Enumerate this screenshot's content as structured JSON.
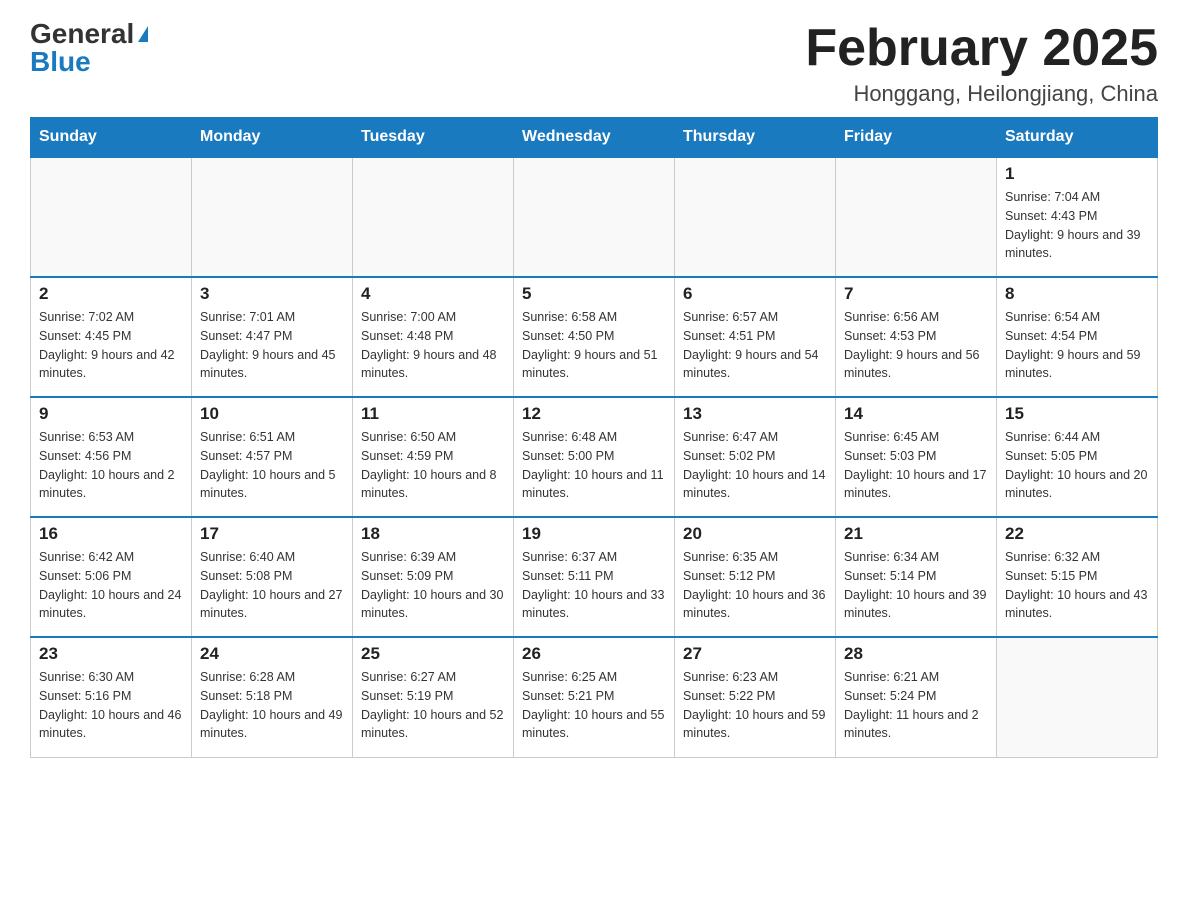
{
  "header": {
    "logo_general": "General",
    "logo_blue": "Blue",
    "month_title": "February 2025",
    "location": "Honggang, Heilongjiang, China"
  },
  "days_of_week": [
    "Sunday",
    "Monday",
    "Tuesday",
    "Wednesday",
    "Thursday",
    "Friday",
    "Saturday"
  ],
  "weeks": [
    [
      {
        "day": "",
        "info": ""
      },
      {
        "day": "",
        "info": ""
      },
      {
        "day": "",
        "info": ""
      },
      {
        "day": "",
        "info": ""
      },
      {
        "day": "",
        "info": ""
      },
      {
        "day": "",
        "info": ""
      },
      {
        "day": "1",
        "info": "Sunrise: 7:04 AM\nSunset: 4:43 PM\nDaylight: 9 hours and 39 minutes."
      }
    ],
    [
      {
        "day": "2",
        "info": "Sunrise: 7:02 AM\nSunset: 4:45 PM\nDaylight: 9 hours and 42 minutes."
      },
      {
        "day": "3",
        "info": "Sunrise: 7:01 AM\nSunset: 4:47 PM\nDaylight: 9 hours and 45 minutes."
      },
      {
        "day": "4",
        "info": "Sunrise: 7:00 AM\nSunset: 4:48 PM\nDaylight: 9 hours and 48 minutes."
      },
      {
        "day": "5",
        "info": "Sunrise: 6:58 AM\nSunset: 4:50 PM\nDaylight: 9 hours and 51 minutes."
      },
      {
        "day": "6",
        "info": "Sunrise: 6:57 AM\nSunset: 4:51 PM\nDaylight: 9 hours and 54 minutes."
      },
      {
        "day": "7",
        "info": "Sunrise: 6:56 AM\nSunset: 4:53 PM\nDaylight: 9 hours and 56 minutes."
      },
      {
        "day": "8",
        "info": "Sunrise: 6:54 AM\nSunset: 4:54 PM\nDaylight: 9 hours and 59 minutes."
      }
    ],
    [
      {
        "day": "9",
        "info": "Sunrise: 6:53 AM\nSunset: 4:56 PM\nDaylight: 10 hours and 2 minutes."
      },
      {
        "day": "10",
        "info": "Sunrise: 6:51 AM\nSunset: 4:57 PM\nDaylight: 10 hours and 5 minutes."
      },
      {
        "day": "11",
        "info": "Sunrise: 6:50 AM\nSunset: 4:59 PM\nDaylight: 10 hours and 8 minutes."
      },
      {
        "day": "12",
        "info": "Sunrise: 6:48 AM\nSunset: 5:00 PM\nDaylight: 10 hours and 11 minutes."
      },
      {
        "day": "13",
        "info": "Sunrise: 6:47 AM\nSunset: 5:02 PM\nDaylight: 10 hours and 14 minutes."
      },
      {
        "day": "14",
        "info": "Sunrise: 6:45 AM\nSunset: 5:03 PM\nDaylight: 10 hours and 17 minutes."
      },
      {
        "day": "15",
        "info": "Sunrise: 6:44 AM\nSunset: 5:05 PM\nDaylight: 10 hours and 20 minutes."
      }
    ],
    [
      {
        "day": "16",
        "info": "Sunrise: 6:42 AM\nSunset: 5:06 PM\nDaylight: 10 hours and 24 minutes."
      },
      {
        "day": "17",
        "info": "Sunrise: 6:40 AM\nSunset: 5:08 PM\nDaylight: 10 hours and 27 minutes."
      },
      {
        "day": "18",
        "info": "Sunrise: 6:39 AM\nSunset: 5:09 PM\nDaylight: 10 hours and 30 minutes."
      },
      {
        "day": "19",
        "info": "Sunrise: 6:37 AM\nSunset: 5:11 PM\nDaylight: 10 hours and 33 minutes."
      },
      {
        "day": "20",
        "info": "Sunrise: 6:35 AM\nSunset: 5:12 PM\nDaylight: 10 hours and 36 minutes."
      },
      {
        "day": "21",
        "info": "Sunrise: 6:34 AM\nSunset: 5:14 PM\nDaylight: 10 hours and 39 minutes."
      },
      {
        "day": "22",
        "info": "Sunrise: 6:32 AM\nSunset: 5:15 PM\nDaylight: 10 hours and 43 minutes."
      }
    ],
    [
      {
        "day": "23",
        "info": "Sunrise: 6:30 AM\nSunset: 5:16 PM\nDaylight: 10 hours and 46 minutes."
      },
      {
        "day": "24",
        "info": "Sunrise: 6:28 AM\nSunset: 5:18 PM\nDaylight: 10 hours and 49 minutes."
      },
      {
        "day": "25",
        "info": "Sunrise: 6:27 AM\nSunset: 5:19 PM\nDaylight: 10 hours and 52 minutes."
      },
      {
        "day": "26",
        "info": "Sunrise: 6:25 AM\nSunset: 5:21 PM\nDaylight: 10 hours and 55 minutes."
      },
      {
        "day": "27",
        "info": "Sunrise: 6:23 AM\nSunset: 5:22 PM\nDaylight: 10 hours and 59 minutes."
      },
      {
        "day": "28",
        "info": "Sunrise: 6:21 AM\nSunset: 5:24 PM\nDaylight: 11 hours and 2 minutes."
      },
      {
        "day": "",
        "info": ""
      }
    ]
  ]
}
